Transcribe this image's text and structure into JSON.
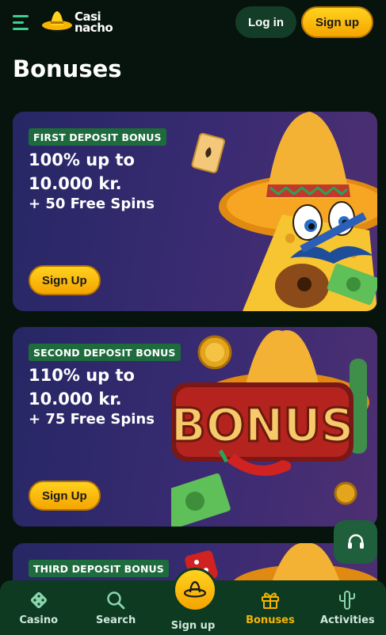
{
  "header": {
    "logo_line1": "Casi",
    "logo_line2": "nacho",
    "login_label": "Log in",
    "signup_label": "Sign up"
  },
  "page": {
    "title": "Bonuses"
  },
  "bonuses": [
    {
      "badge": "FIRST DEPOSIT BONUS",
      "line1": "100% up to",
      "line2": "10.000 kr.",
      "spins": "+ 50 Free Spins",
      "button": "Sign Up"
    },
    {
      "badge": "SECOND DEPOSIT BONUS",
      "line1": "110% up to",
      "line2": "10.000 kr.",
      "spins": "+ 75 Free Spins",
      "button": "Sign Up"
    },
    {
      "badge": "THIRD DEPOSIT BONUS"
    }
  ],
  "art": {
    "bonus_word": "BONUS"
  },
  "nav": {
    "items": [
      {
        "label": "Casino",
        "icon": "dice-icon"
      },
      {
        "label": "Search",
        "icon": "search-icon"
      },
      {
        "label": "Sign up",
        "icon": "sombrero-icon"
      },
      {
        "label": "Bonuses",
        "icon": "gift-icon",
        "active": true
      },
      {
        "label": "Activities",
        "icon": "cactus-icon"
      }
    ]
  },
  "colors": {
    "accent_yellow": "#f7b500",
    "brand_green": "#3ecf8e",
    "nav_bg": "#0e3a22",
    "badge_green": "#1e6b3d"
  }
}
